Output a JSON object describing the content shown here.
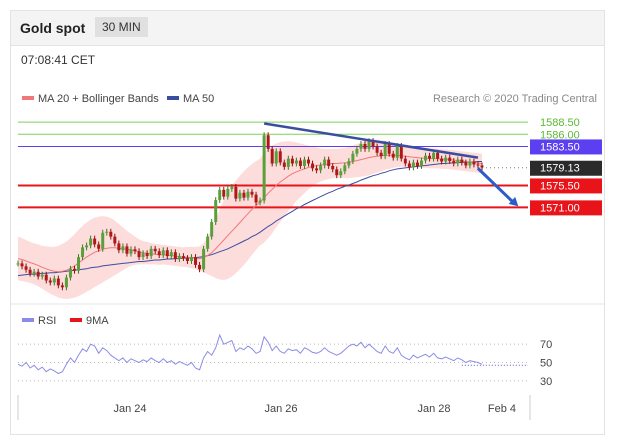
{
  "header": {
    "title": "Gold spot",
    "interval": "30 MIN"
  },
  "timestamp": "07:08:41 CET",
  "credit": "Research © 2020 Trading Central",
  "colors": {
    "support": "#e8141a",
    "resistance": "#5b3ff0",
    "last": "#2b2b2b",
    "green": "#7cd25a",
    "band": "#fdd6d6",
    "ma20": "#f07878",
    "ma50": "#3a4ea0",
    "rsi": "#8c8ce6",
    "rsi9": "#e8141a"
  },
  "chart_data": [
    {
      "type": "line",
      "legend": [
        {
          "name": "MA 20 + Bollinger Bands",
          "color": "#f07878"
        },
        {
          "name": "MA 50",
          "color": "#3a4ea0"
        }
      ],
      "x_ticks": [
        "Jan 24",
        "Jan 26",
        "Jan 28",
        "Feb 4"
      ],
      "ylim": [
        1552,
        1592
      ],
      "levels": [
        {
          "value": 1588.5,
          "label": "1588.50",
          "kind": "target"
        },
        {
          "value": 1586.0,
          "label": "1586.00",
          "kind": "target"
        },
        {
          "value": 1583.5,
          "label": "1583.50",
          "kind": "resistance"
        },
        {
          "value": 1579.13,
          "label": "1579.13",
          "kind": "last"
        },
        {
          "value": 1575.5,
          "label": "1575.50",
          "kind": "support"
        },
        {
          "value": 1571.0,
          "label": "1571.00",
          "kind": "support"
        }
      ],
      "price": [
        1559.5,
        1558.9,
        1558.2,
        1557.4,
        1557.8,
        1556.8,
        1557.2,
        1556.0,
        1555.6,
        1556.4,
        1555.0,
        1554.6,
        1556.6,
        1558.4,
        1558.0,
        1560.8,
        1562.8,
        1563.2,
        1564.6,
        1563.4,
        1562.5,
        1565.8,
        1566.0,
        1565.0,
        1563.6,
        1562.2,
        1563.0,
        1561.5,
        1562.4,
        1562.0,
        1560.8,
        1561.6,
        1561.0,
        1562.5,
        1562.0,
        1561.2,
        1562.2,
        1561.0,
        1561.8,
        1560.4,
        1561.0,
        1560.6,
        1560.0,
        1560.8,
        1559.2,
        1558.3,
        1562.5,
        1565.0,
        1568.0,
        1572.5,
        1574.6,
        1573.2,
        1574.8,
        1575.2,
        1572.8,
        1574.0,
        1573.0,
        1574.2,
        1573.6,
        1572.0,
        1572.4,
        1585.8,
        1583.0,
        1580.0,
        1582.5,
        1580.2,
        1579.3,
        1581.0,
        1580.0,
        1580.6,
        1579.5,
        1580.8,
        1580.0,
        1579.0,
        1578.6,
        1579.6,
        1580.8,
        1579.5,
        1578.8,
        1577.6,
        1578.4,
        1579.6,
        1580.5,
        1582.0,
        1583.0,
        1584.0,
        1583.0,
        1584.6,
        1583.5,
        1582.2,
        1581.5,
        1584.0,
        1582.0,
        1581.2,
        1583.6,
        1581.0,
        1580.0,
        1579.2,
        1580.2,
        1579.5,
        1580.6,
        1581.6,
        1581.0,
        1582.2,
        1581.0,
        1580.4,
        1581.2,
        1580.5,
        1580.0,
        1580.8,
        1580.2,
        1579.6,
        1580.4,
        1579.8,
        1579.6,
        1579.2
      ],
      "ma20": [
        1560.5,
        1560.3,
        1560.0,
        1559.7,
        1559.4,
        1559.1,
        1558.7,
        1558.4,
        1558.1,
        1557.9,
        1557.8,
        1557.9,
        1558.1,
        1558.5,
        1559.0,
        1559.6,
        1560.2,
        1560.8,
        1561.3,
        1561.8,
        1562.1,
        1562.4,
        1562.6,
        1562.7,
        1562.7,
        1562.6,
        1562.5,
        1562.4,
        1562.3,
        1562.1,
        1561.9,
        1561.7,
        1561.6,
        1561.5,
        1561.4,
        1561.3,
        1561.3,
        1561.2,
        1561.1,
        1561.0,
        1560.9,
        1560.8,
        1560.8,
        1560.7,
        1560.6,
        1560.5,
        1560.7,
        1561.1,
        1561.7,
        1562.5,
        1563.4,
        1564.3,
        1565.2,
        1566.1,
        1567.0,
        1567.9,
        1568.8,
        1569.7,
        1570.6,
        1571.4,
        1572.1,
        1573.0,
        1573.9,
        1574.7,
        1575.5,
        1576.2,
        1576.8,
        1577.4,
        1577.9,
        1578.3,
        1578.6,
        1578.9,
        1579.2,
        1579.4,
        1579.6,
        1579.7,
        1579.8,
        1579.9,
        1580.0,
        1580.0,
        1580.1,
        1580.1,
        1580.2,
        1580.4,
        1580.6,
        1580.8,
        1581.0,
        1581.2,
        1581.4,
        1581.5,
        1581.6,
        1581.7,
        1581.7,
        1581.7,
        1581.7,
        1581.6,
        1581.5,
        1581.4,
        1581.3,
        1581.2,
        1581.1,
        1581.1,
        1581.0,
        1581.0,
        1581.0,
        1580.9,
        1580.9,
        1580.8,
        1580.7,
        1580.6,
        1580.5,
        1580.4,
        1580.3,
        1580.2,
        1580.1,
        1580.0
      ],
      "ma50": [
        1557.0,
        1557.1,
        1557.2,
        1557.3,
        1557.3,
        1557.4,
        1557.5,
        1557.5,
        1557.6,
        1557.6,
        1557.7,
        1557.8,
        1557.9,
        1558.0,
        1558.1,
        1558.2,
        1558.3,
        1558.4,
        1558.6,
        1558.7,
        1558.8,
        1559.0,
        1559.1,
        1559.2,
        1559.3,
        1559.4,
        1559.5,
        1559.6,
        1559.7,
        1559.8,
        1559.9,
        1559.9,
        1560.0,
        1560.1,
        1560.2,
        1560.2,
        1560.3,
        1560.4,
        1560.4,
        1560.5,
        1560.5,
        1560.6,
        1560.6,
        1560.7,
        1560.7,
        1560.8,
        1560.9,
        1561.1,
        1561.3,
        1561.6,
        1561.9,
        1562.2,
        1562.5,
        1562.9,
        1563.3,
        1563.7,
        1564.1,
        1564.5,
        1565.0,
        1565.4,
        1565.9,
        1566.5,
        1567.1,
        1567.6,
        1568.2,
        1568.7,
        1569.2,
        1569.7,
        1570.2,
        1570.7,
        1571.1,
        1571.6,
        1572.0,
        1572.4,
        1572.8,
        1573.2,
        1573.6,
        1574.0,
        1574.3,
        1574.7,
        1575.0,
        1575.3,
        1575.6,
        1575.9,
        1576.2,
        1576.6,
        1576.9,
        1577.2,
        1577.5,
        1577.7,
        1578.0,
        1578.2,
        1578.5,
        1578.7,
        1578.9,
        1579.0,
        1579.1,
        1579.2,
        1579.3,
        1579.4,
        1579.5,
        1579.6,
        1579.7,
        1579.8,
        1579.9,
        1580.0,
        1580.0,
        1580.1,
        1580.1,
        1580.2,
        1580.2,
        1580.3,
        1580.3,
        1580.3,
        1580.4,
        1580.4
      ],
      "band_width": [
        4.5,
        4.4,
        4.3,
        4.2,
        4.2,
        4.3,
        4.4,
        4.6,
        4.8,
        5.0,
        5.3,
        5.6,
        5.9,
        6.2,
        6.5,
        6.8,
        7.0,
        7.1,
        7.2,
        7.1,
        7.0,
        6.8,
        6.5,
        6.1,
        5.6,
        5.0,
        4.4,
        3.8,
        3.3,
        2.9,
        2.6,
        2.4,
        2.3,
        2.2,
        2.1,
        2.1,
        2.0,
        2.0,
        2.0,
        2.0,
        2.0,
        2.0,
        2.1,
        2.2,
        2.3,
        2.5,
        3.0,
        3.8,
        4.8,
        6.0,
        7.2,
        8.2,
        8.9,
        9.3,
        9.5,
        9.6,
        9.6,
        9.5,
        9.3,
        9.1,
        8.9,
        9.2,
        9.2,
        9.0,
        8.6,
        8.2,
        7.7,
        7.2,
        6.6,
        6.0,
        5.5,
        5.0,
        4.5,
        4.1,
        3.7,
        3.4,
        3.2,
        3.1,
        3.0,
        3.0,
        3.0,
        3.1,
        3.2,
        3.3,
        3.4,
        3.5,
        3.6,
        3.6,
        3.5,
        3.4,
        3.2,
        3.0,
        2.8,
        2.6,
        2.4,
        2.3,
        2.2,
        2.1,
        2.0,
        2.0,
        2.0,
        2.0,
        2.0,
        2.0,
        2.0,
        2.0,
        2.0,
        2.0,
        2.0,
        2.0,
        2.0,
        2.0,
        2.0,
        2.0,
        2.0,
        2.0
      ],
      "trendline": {
        "from": [
          61,
          1588.2
        ],
        "to": [
          114,
          1581.2
        ]
      },
      "arrow": {
        "from": [
          114,
          1579.0
        ],
        "to": [
          124,
          1571.2
        ]
      }
    },
    {
      "type": "line",
      "legend": [
        {
          "name": "RSI",
          "color": "#8c8ce6"
        },
        {
          "name": "9MA",
          "color": "#e8141a"
        }
      ],
      "y_ticks": [
        70,
        50,
        30
      ],
      "ylim": [
        20,
        80
      ],
      "rsi": [
        48,
        46,
        50,
        44,
        47,
        42,
        45,
        40,
        43,
        41,
        38,
        40,
        48,
        55,
        50,
        58,
        65,
        62,
        70,
        68,
        60,
        66,
        63,
        58,
        55,
        52,
        55,
        50,
        54,
        52,
        50,
        53,
        51,
        55,
        52,
        50,
        54,
        50,
        52,
        48,
        51,
        49,
        47,
        50,
        44,
        42,
        55,
        62,
        58,
        66,
        80,
        70,
        72,
        74,
        62,
        66,
        64,
        68,
        65,
        60,
        62,
        78,
        72,
        63,
        68,
        62,
        60,
        65,
        63,
        64,
        60,
        66,
        64,
        61,
        60,
        62,
        66,
        62,
        60,
        58,
        60,
        64,
        68,
        70,
        68,
        72,
        66,
        70,
        66,
        62,
        60,
        68,
        62,
        60,
        66,
        58,
        55,
        53,
        58,
        55,
        57,
        59,
        56,
        60,
        55,
        54,
        56,
        54,
        52,
        55,
        53,
        50,
        52,
        51,
        50,
        48
      ],
      "ma9_dotted_start": 110,
      "ma9_level": 47
    }
  ]
}
